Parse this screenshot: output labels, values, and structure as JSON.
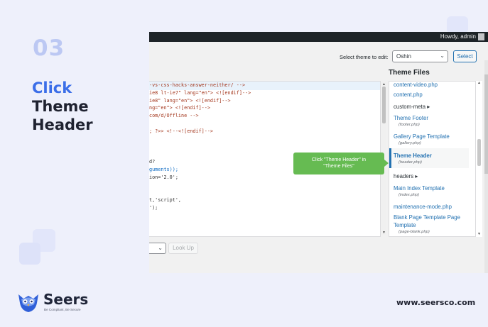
{
  "step": {
    "number": "03",
    "title_accent": "Click",
    "title_line2": "Theme",
    "title_line3": "Header"
  },
  "admin_bar": {
    "greeting": "Howdy, admin"
  },
  "toolbar": {
    "select_label": "Select theme to edit:",
    "theme_value": "Oshin",
    "select_button": "Select"
  },
  "editor": {
    "lines": [
      {
        "text": "-vs-css-hacks-answer-neither/ -->",
        "color": "#a3361c"
      },
      {
        "text": "ie8 lt-ie7\" lang=\"en\"> <![endif]-->",
        "color": "#a3361c"
      },
      {
        "text": "ie8\" lang=\"en\"> <![endif]-->",
        "color": "#a3361c"
      },
      {
        "text": "ng=\"en\"> <![endif]-->",
        "color": "#a3361c"
      },
      {
        "text": "com/d/Offline -->",
        "color": "#a3361c"
      },
      {
        "text": "",
        "color": "#333333"
      },
      {
        "text": "; ?>> <!--<![endif]-->",
        "color": "#a3361c"
      },
      {
        "text": "",
        "color": "#333333"
      },
      {
        "text": "",
        "color": "#333333"
      },
      {
        "text": "",
        "color": "#333333"
      },
      {
        "text": "d?",
        "color": "#333333"
      },
      {
        "text": "guments));",
        "color": "#0a69c2"
      },
      {
        "text": "ion='2.0';",
        "color": "#333333"
      },
      {
        "text": "",
        "color": "#333333"
      },
      {
        "text": "",
        "color": "#333333"
      },
      {
        "text": "t,'script',",
        "color": "#333333"
      },
      {
        "text": "');",
        "color": "#333333"
      }
    ]
  },
  "files": {
    "heading": "Theme Files",
    "items": [
      {
        "label": "content-video.php",
        "type": "file"
      },
      {
        "label": "content.php",
        "type": "file"
      },
      {
        "label": "custom-meta ▸",
        "type": "dir"
      },
      {
        "label": "Theme Footer",
        "type": "file",
        "sub": "(footer.php)"
      },
      {
        "label": "Gallery Page Template",
        "type": "file",
        "sub": "(gallery.php)"
      },
      {
        "label": "Theme Header",
        "type": "active",
        "sub": "(header.php)"
      },
      {
        "label": "headers ▸",
        "type": "dir"
      },
      {
        "label": "Main Index Template",
        "type": "file",
        "sub": "(index.php)"
      },
      {
        "label": "maintenance-mode.php",
        "type": "file"
      },
      {
        "label": "Blank Page Template Page",
        "type": "file"
      },
      {
        "label": "Template",
        "type": "file",
        "sub": "(page-blank.php)"
      }
    ]
  },
  "callout": {
    "line1": "Click \"Theme Header\" in",
    "line2": "\"Theme Files\""
  },
  "bottom": {
    "lookup_button": "Look Up"
  },
  "footer": {
    "brand": "Seers",
    "tagline": "Be Compliant, Be Secure",
    "website": "www.seersco.com"
  },
  "colors": {
    "accent": "#3b6ee8",
    "callout": "#66bb52",
    "link": "#2271b1",
    "background": "#eef0fb"
  }
}
